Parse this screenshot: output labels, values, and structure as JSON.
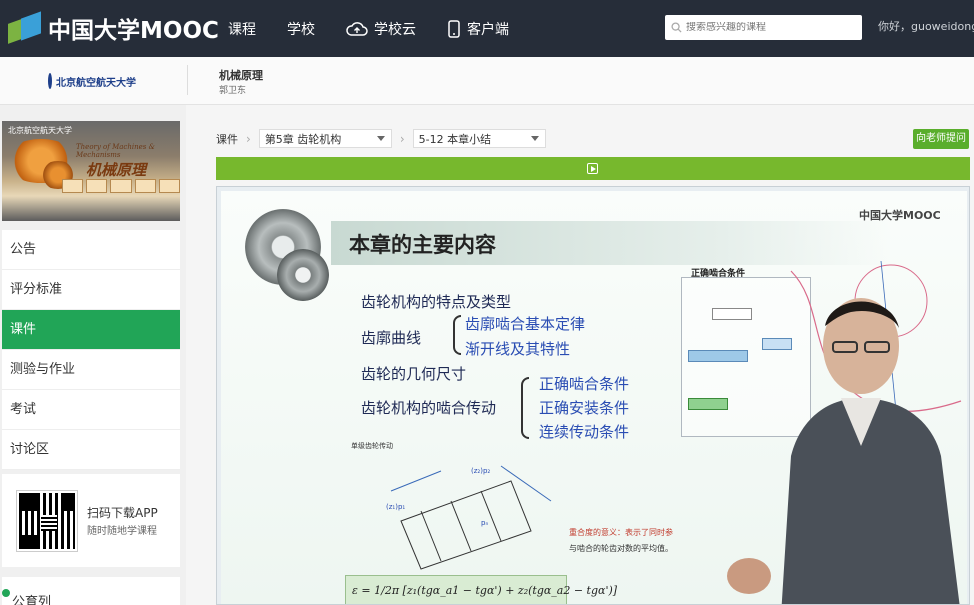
{
  "topbar": {
    "logo_text": "中国大学MOOC",
    "nav": [
      {
        "label": "课程",
        "icon": ""
      },
      {
        "label": "学校",
        "icon": ""
      },
      {
        "label": "学校云",
        "icon": "cloud-icon"
      },
      {
        "label": "客户端",
        "icon": "phone-icon"
      }
    ],
    "search_placeholder": "搜索感兴趣的课程",
    "greeting": "你好，guoweidong"
  },
  "course_header": {
    "school_name": "北京航空航天大学",
    "course_title": "机械原理",
    "teacher": "郭卫东"
  },
  "sidebar": {
    "cover": {
      "school": "北京航空航天大学",
      "subtitle": "Theory of Machines & Mechanisms",
      "title": "机械原理"
    },
    "menu": [
      {
        "label": "公告",
        "active": false
      },
      {
        "label": "评分标准",
        "active": false
      },
      {
        "label": "课件",
        "active": true
      },
      {
        "label": "测验与作业",
        "active": false
      },
      {
        "label": "考试",
        "active": false
      },
      {
        "label": "讨论区",
        "active": false
      }
    ],
    "app_title": "扫码下载APP",
    "app_subtitle": "随时随地学课程",
    "more_label": "公育列"
  },
  "main": {
    "breadcrumb_root": "课件",
    "chapter_select": "第5章 齿轮机构",
    "section_select": "5-12 本章小结",
    "ask_button": "向老师提问"
  },
  "slide": {
    "mooc_mark": "中国大学MOOC",
    "title": "本章的主要内容",
    "lines": [
      "齿轮机构的特点及类型",
      "齿廓曲线",
      "齿廓啮合基本定律",
      "渐开线及其特性",
      "齿轮的几何尺寸",
      "齿轮机构的啮合传动",
      "正确啮合条件",
      "正确安装条件",
      "连续传动条件"
    ],
    "panel_title": "正确啮合条件",
    "diagram_label": "单级齿轮传动",
    "red_note": "重合度的意义：表示了同时参",
    "red_note2": "与啮合的轮齿对数的平均值。",
    "formula": "ε = 1/2π [z₁(tgα_a1 − tgα') + z₂(tgα_a2 − tgα')]"
  },
  "colors": {
    "topbar_bg": "#262d39",
    "accent_green": "#21a557",
    "play_bar": "#77b82d"
  }
}
